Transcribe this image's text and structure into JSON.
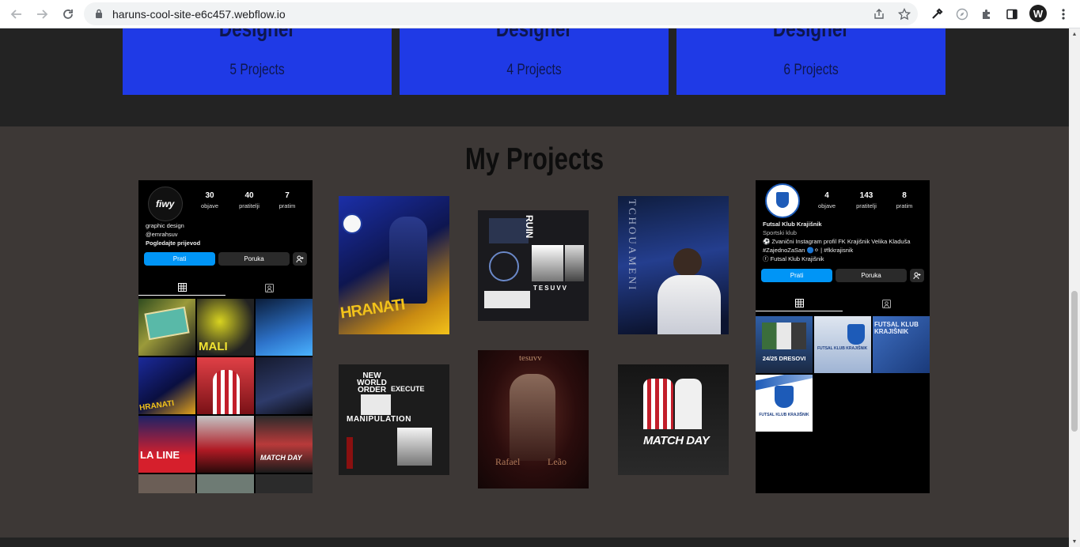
{
  "browser": {
    "url": "haruns-cool-site-e6c457.webflow.io",
    "profile_initial": "W"
  },
  "role_cards": [
    {
      "title": "Designer",
      "count": "5 Projects"
    },
    {
      "title": "Designer",
      "count": "4 Projects"
    },
    {
      "title": "Designer",
      "count": "6 Projects"
    }
  ],
  "section_title": "My Projects",
  "profile_left": {
    "logo_text": "fiwy",
    "stats": [
      {
        "value": "30",
        "label": "objave"
      },
      {
        "value": "40",
        "label": "pratitelji"
      },
      {
        "value": "7",
        "label": "pratim"
      }
    ],
    "bio": [
      "graphic design",
      "@emrahsuv",
      "Pogledajte prijevod"
    ],
    "follow": "Prati",
    "message": "Poruka",
    "grid_labels": [
      "MALI",
      "HRANATI",
      "LA LINE",
      "MATCH DAY"
    ]
  },
  "profile_right": {
    "stats": [
      {
        "value": "4",
        "label": "objave"
      },
      {
        "value": "143",
        "label": "pratitelji"
      },
      {
        "value": "8",
        "label": "pratim"
      }
    ],
    "name": "Futsal Klub Krajišnik",
    "category": "Sportski klub",
    "bio": [
      "⚽ Zvanični Instagram profil FK Krajišnik Velika Kladuša",
      "#ZajednoZaSan 🔵⚪ | #fkkrajisnik",
      "ⓕ Futsal Klub Krajišnik"
    ],
    "follow": "Prati",
    "message": "Poruka",
    "grid_labels": [
      "24/25 DRESOVI",
      "FUTSAL KLUB KRAJIŠNIK",
      "FUTSAL KLUB KRAJIŠNIK",
      "FUTSAL KLUB KRAJIŠNIK"
    ]
  },
  "posters": {
    "hranati": "HRANATI",
    "ruin": "RUIN",
    "tesuvv": "TESUVV",
    "tchouameni": "TCHOUAMENI",
    "nwo_top": "NEW WORLD ORDER",
    "execute": "EXECUTE",
    "manipulation": "MANIPULATION",
    "tesuvv_lower": "tesuvv",
    "rafael": "Rafael",
    "leao": "Leão",
    "matchday": "MATCH DAY"
  },
  "colors": {
    "card_blue": "#1f3ae6",
    "section_bg": "#3d3836",
    "ig_blue": "#0095f6"
  }
}
